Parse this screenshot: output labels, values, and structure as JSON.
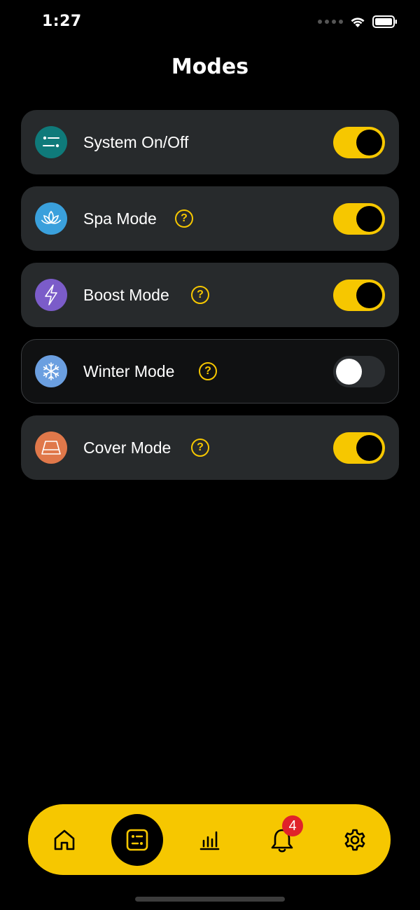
{
  "status_bar": {
    "time": "1:27"
  },
  "header": {
    "title": "Modes"
  },
  "modes": [
    {
      "label": "System On/Off",
      "icon": "sliders-icon",
      "icon_color": "#0f7a7a",
      "has_help": false,
      "enabled": true
    },
    {
      "label": "Spa Mode",
      "icon": "lotus-icon",
      "icon_color": "#3aa0dc",
      "has_help": true,
      "help_label": "?",
      "enabled": true
    },
    {
      "label": "Boost Mode",
      "icon": "lightning-icon",
      "icon_color": "#7b5cc9",
      "has_help": true,
      "help_label": "?",
      "enabled": true
    },
    {
      "label": "Winter Mode",
      "icon": "snowflake-icon",
      "icon_color": "#6b9fe0",
      "has_help": true,
      "help_label": "?",
      "enabled": false
    },
    {
      "label": "Cover Mode",
      "icon": "cover-icon",
      "icon_color": "#e0784a",
      "has_help": true,
      "help_label": "?",
      "enabled": true
    }
  ],
  "tab_bar": {
    "tabs": [
      {
        "name": "home",
        "icon": "home-icon"
      },
      {
        "name": "modes",
        "icon": "modes-icon",
        "active": true
      },
      {
        "name": "stats",
        "icon": "bar-chart-icon"
      },
      {
        "name": "notifications",
        "icon": "bell-icon"
      },
      {
        "name": "settings",
        "icon": "gear-icon"
      }
    ],
    "notification_count": "4"
  },
  "colors": {
    "accent": "#f6c700",
    "background": "#000000",
    "card": "#272a2c",
    "badge": "#e0222a"
  }
}
